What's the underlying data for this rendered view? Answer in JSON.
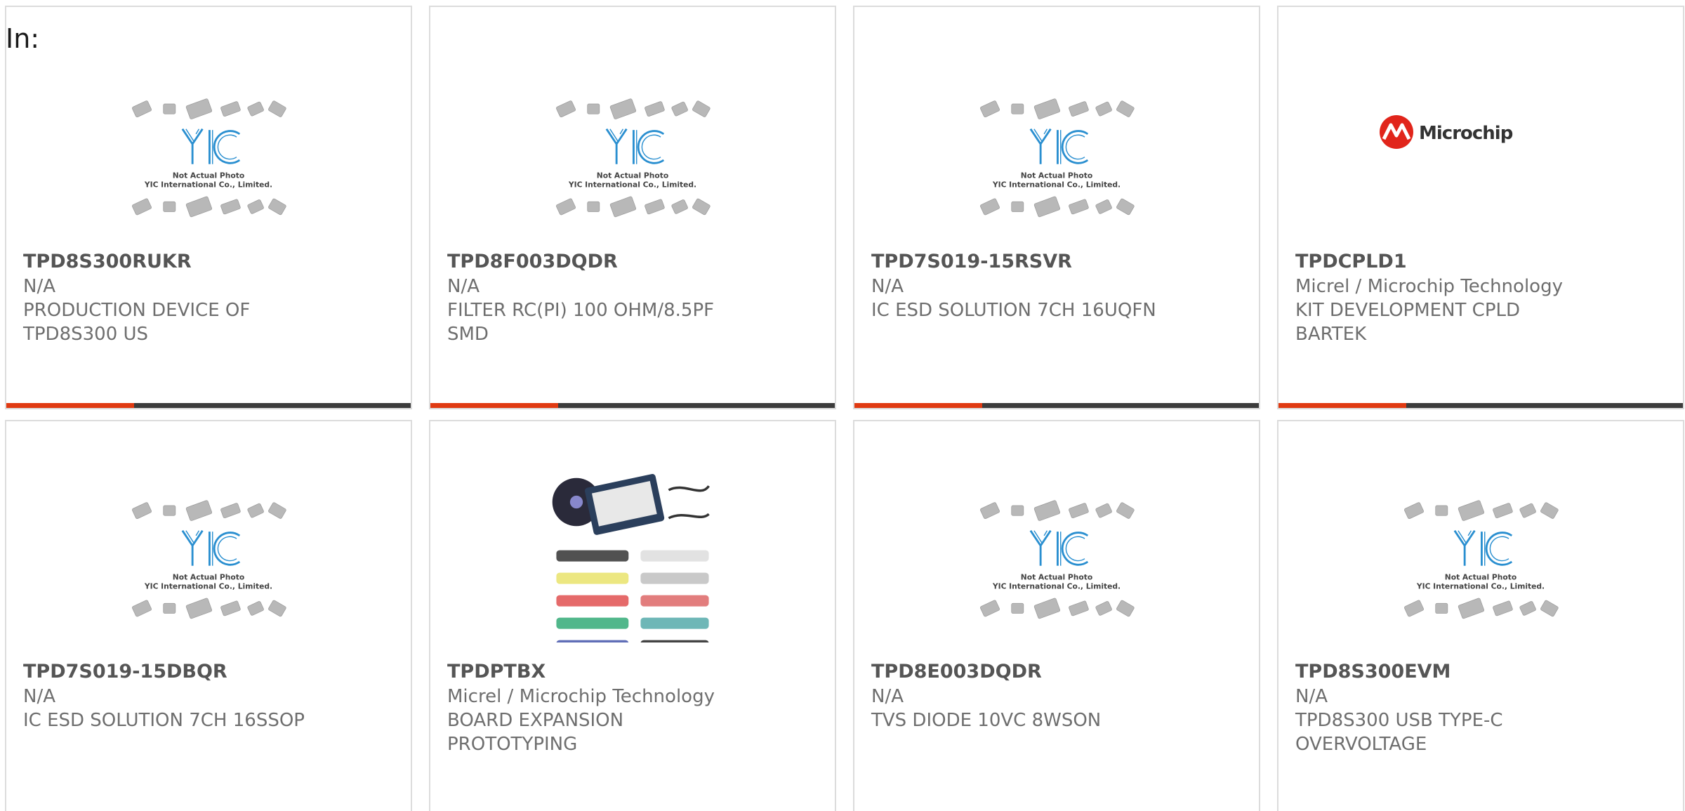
{
  "heading": "In:",
  "colors": {
    "accent": "#e03a12",
    "bar": "#3c3c3c",
    "border": "#dcdcdc",
    "text": "#6e6e6e"
  },
  "products": [
    {
      "part_number": "TPD8S300RUKR",
      "manufacturer": "N/A",
      "description": "PRODUCTION DEVICE OF TPD8S300 US",
      "image": "yic-placeholder",
      "image_caption_1": "Not Actual Photo",
      "image_caption_2": "YIC International Co., Limited."
    },
    {
      "part_number": "TPD8F003DQDR",
      "manufacturer": "N/A",
      "description": "FILTER RC(PI) 100 OHM/8.5PF SMD",
      "image": "yic-placeholder",
      "image_caption_1": "Not Actual Photo",
      "image_caption_2": "YIC International Co., Limited."
    },
    {
      "part_number": "TPD7S019-15RSVR",
      "manufacturer": "N/A",
      "description": "IC ESD SOLUTION 7CH 16UQFN",
      "image": "yic-placeholder",
      "image_caption_1": "Not Actual Photo",
      "image_caption_2": "YIC International Co., Limited."
    },
    {
      "part_number": "TPDCPLD1",
      "manufacturer": "Micrel / Microchip Technology",
      "description": "KIT DEVELOPMENT CPLD BARTEK",
      "image": "microchip-logo",
      "logo_text": "Microchip"
    },
    {
      "part_number": "TPD7S019-15DBQR",
      "manufacturer": "N/A",
      "description": "IC ESD SOLUTION 7CH 16SSOP",
      "image": "yic-placeholder",
      "image_caption_1": "Not Actual Photo",
      "image_caption_2": "YIC International Co., Limited."
    },
    {
      "part_number": "TPDPTBX",
      "manufacturer": "Micrel / Microchip Technology",
      "description": "BOARD EXPANSION PROTOTYPING",
      "image": "prototyping-kit-photo"
    },
    {
      "part_number": "TPD8E003DQDR",
      "manufacturer": "N/A",
      "description": "TVS DIODE 10VC 8WSON",
      "image": "yic-placeholder",
      "image_caption_1": "Not Actual Photo",
      "image_caption_2": "YIC International Co., Limited."
    },
    {
      "part_number": "TPD8S300EVM",
      "manufacturer": "N/A",
      "description": "TPD8S300 USB TYPE-C OVERVOLTAGE",
      "image": "yic-placeholder",
      "image_caption_1": "Not Actual Photo",
      "image_caption_2": "YIC International Co., Limited."
    }
  ]
}
